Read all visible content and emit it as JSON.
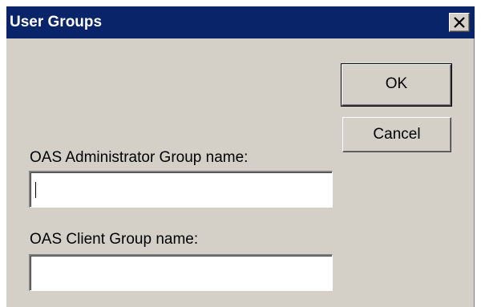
{
  "window": {
    "title": "User Groups",
    "close_icon": "close-icon"
  },
  "buttons": {
    "ok_label": "OK",
    "cancel_label": "Cancel"
  },
  "form": {
    "admin_group": {
      "label": "OAS Administrator Group name:",
      "value": ""
    },
    "client_group": {
      "label": "OAS Client Group name:",
      "value": ""
    }
  },
  "colors": {
    "title_bar": "#0a246a",
    "dialog_face": "#d4d0c8",
    "field_background": "#ffffff"
  }
}
